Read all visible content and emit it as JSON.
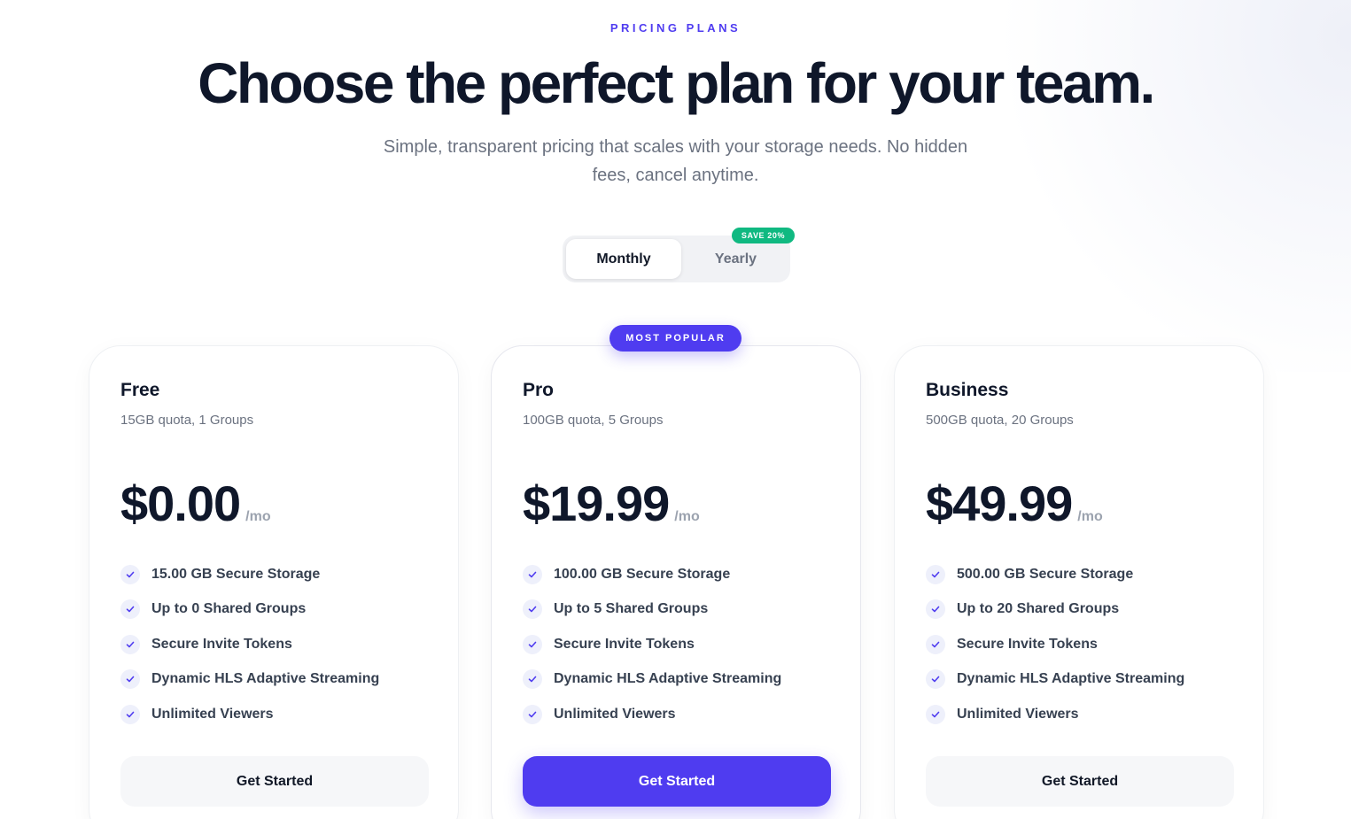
{
  "header": {
    "eyebrow": "PRICING PLANS",
    "title": "Choose the perfect plan for your team.",
    "subtitle": "Simple, transparent pricing that scales with your storage needs. No hidden fees, cancel anytime."
  },
  "billing_toggle": {
    "monthly_label": "Monthly",
    "yearly_label": "Yearly",
    "save_badge": "SAVE 20%",
    "selected": "Monthly"
  },
  "popular_badge": "MOST POPULAR",
  "colors": {
    "accent": "#4f3cf0",
    "save_green": "#10b981",
    "heading": "#0f172a",
    "muted": "#6b7280"
  },
  "plans": [
    {
      "name": "Free",
      "description": "15GB quota, 1 Groups",
      "price": "$0.00",
      "period": "/mo",
      "features": [
        "15.00 GB Secure Storage",
        "Up to 0 Shared Groups",
        "Secure Invite Tokens",
        "Dynamic HLS Adaptive Streaming",
        "Unlimited Viewers"
      ],
      "cta": "Get Started"
    },
    {
      "name": "Pro",
      "description": "100GB quota, 5 Groups",
      "price": "$19.99",
      "period": "/mo",
      "features": [
        "100.00 GB Secure Storage",
        "Up to 5 Shared Groups",
        "Secure Invite Tokens",
        "Dynamic HLS Adaptive Streaming",
        "Unlimited Viewers"
      ],
      "cta": "Get Started"
    },
    {
      "name": "Business",
      "description": "500GB quota, 20 Groups",
      "price": "$49.99",
      "period": "/mo",
      "features": [
        "500.00 GB Secure Storage",
        "Up to 20 Shared Groups",
        "Secure Invite Tokens",
        "Dynamic HLS Adaptive Streaming",
        "Unlimited Viewers"
      ],
      "cta": "Get Started"
    }
  ]
}
